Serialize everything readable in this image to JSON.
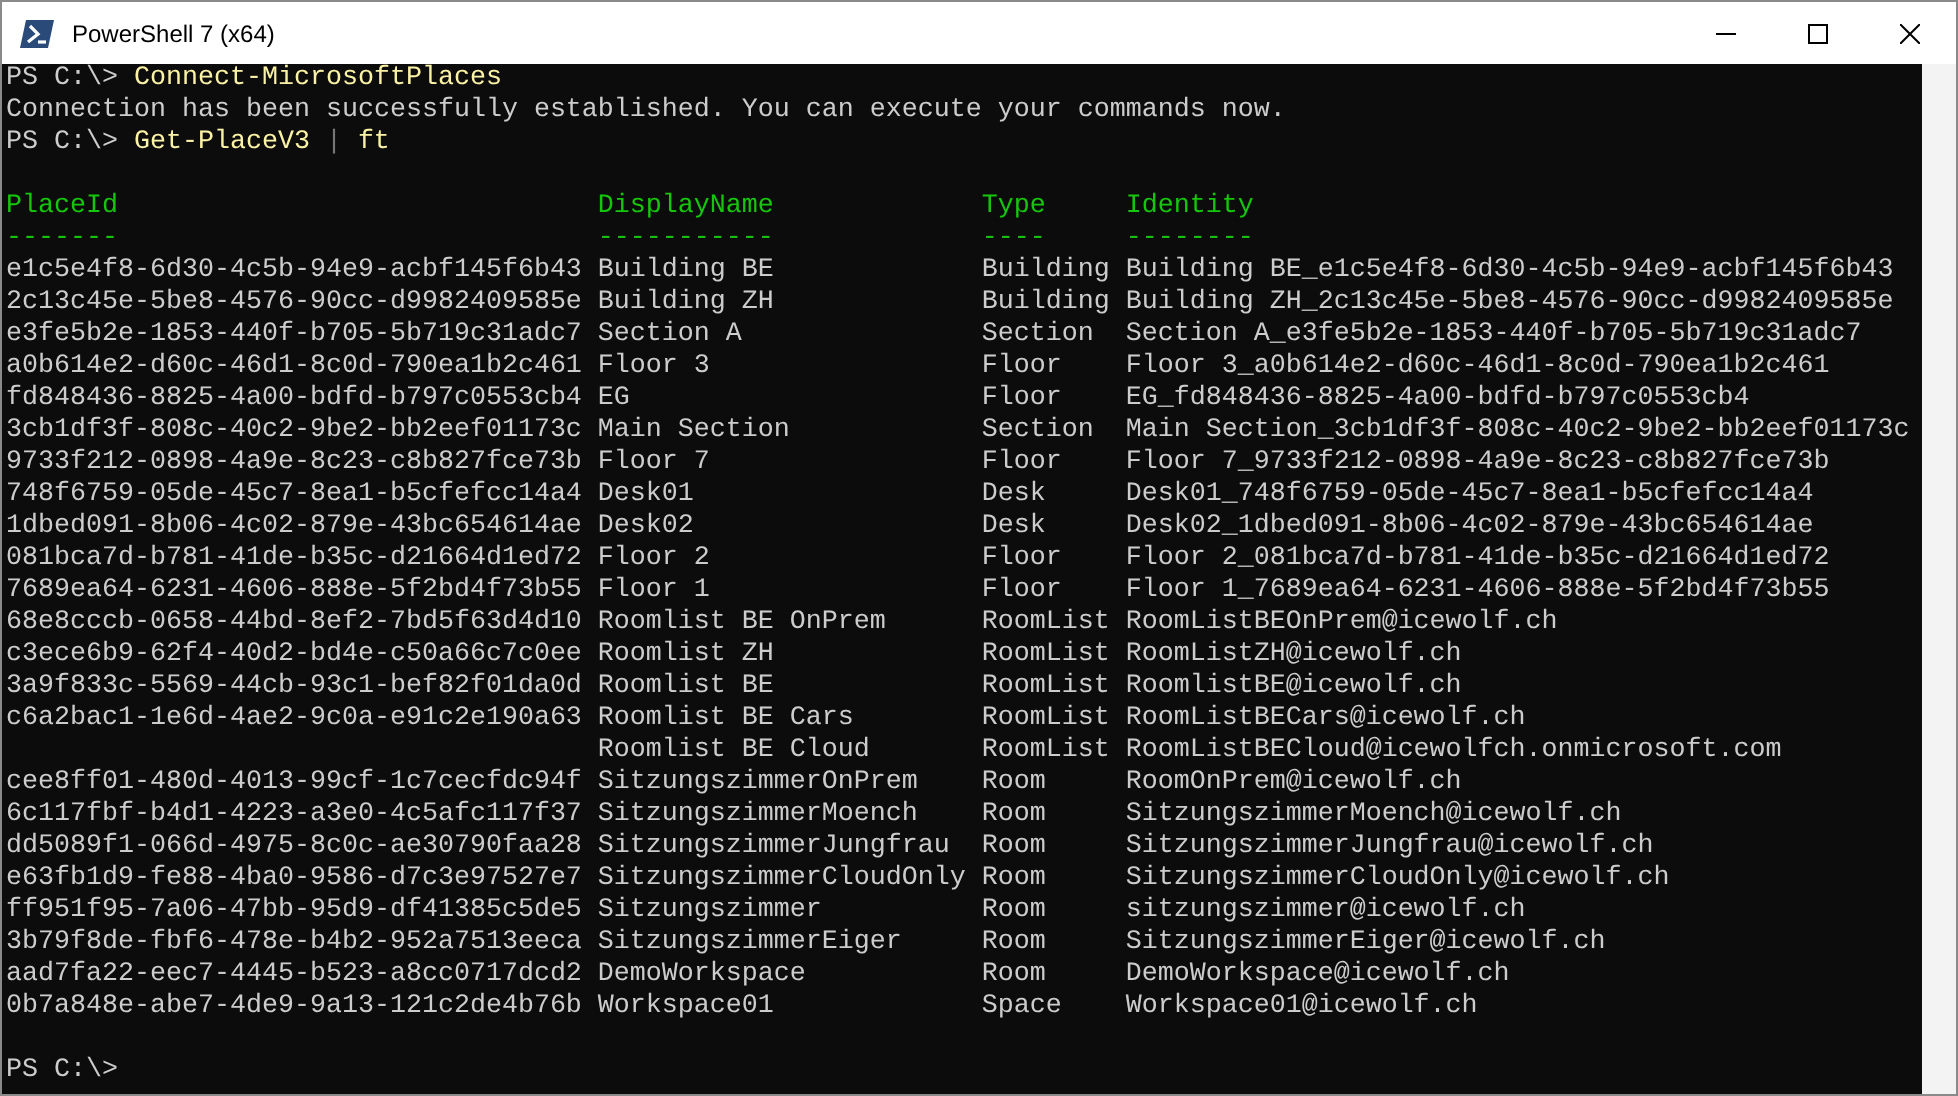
{
  "window": {
    "title": "PowerShell 7 (x64)"
  },
  "session_start": [
    {
      "kind": "command",
      "prompt": "PS C:\\>",
      "command": "Connect-MicrosoftPlaces"
    },
    {
      "kind": "output",
      "text": "Connection has been successfully established. You can execute your commands now."
    },
    {
      "kind": "command",
      "prompt": "PS C:\\>",
      "command": "Get-PlaceV3",
      "pipe": "|",
      "argument": "ft"
    }
  ],
  "table": {
    "columns": [
      {
        "heading": "PlaceId",
        "underline": "-------"
      },
      {
        "heading": "DisplayName",
        "underline": "-----------"
      },
      {
        "heading": "Type",
        "underline": "----"
      },
      {
        "heading": "Identity",
        "underline": "--------"
      }
    ],
    "rows": [
      {
        "place_id": "e1c5e4f8-6d30-4c5b-94e9-acbf145f6b43",
        "display_name": "Building BE",
        "type": "Building",
        "identity": "Building BE_e1c5e4f8-6d30-4c5b-94e9-acbf145f6b43"
      },
      {
        "place_id": "2c13c45e-5be8-4576-90cc-d9982409585e",
        "display_name": "Building ZH",
        "type": "Building",
        "identity": "Building ZH_2c13c45e-5be8-4576-90cc-d9982409585e"
      },
      {
        "place_id": "e3fe5b2e-1853-440f-b705-5b719c31adc7",
        "display_name": "Section A",
        "type": "Section",
        "identity": "Section A_e3fe5b2e-1853-440f-b705-5b719c31adc7"
      },
      {
        "place_id": "a0b614e2-d60c-46d1-8c0d-790ea1b2c461",
        "display_name": "Floor 3",
        "type": "Floor",
        "identity": "Floor 3_a0b614e2-d60c-46d1-8c0d-790ea1b2c461"
      },
      {
        "place_id": "fd848436-8825-4a00-bdfd-b797c0553cb4",
        "display_name": "EG",
        "type": "Floor",
        "identity": "EG_fd848436-8825-4a00-bdfd-b797c0553cb4"
      },
      {
        "place_id": "3cb1df3f-808c-40c2-9be2-bb2eef01173c",
        "display_name": "Main Section",
        "type": "Section",
        "identity": "Main Section_3cb1df3f-808c-40c2-9be2-bb2eef01173c"
      },
      {
        "place_id": "9733f212-0898-4a9e-8c23-c8b827fce73b",
        "display_name": "Floor 7",
        "type": "Floor",
        "identity": "Floor 7_9733f212-0898-4a9e-8c23-c8b827fce73b"
      },
      {
        "place_id": "748f6759-05de-45c7-8ea1-b5cfefcc14a4",
        "display_name": "Desk01",
        "type": "Desk",
        "identity": "Desk01_748f6759-05de-45c7-8ea1-b5cfefcc14a4"
      },
      {
        "place_id": "1dbed091-8b06-4c02-879e-43bc654614ae",
        "display_name": "Desk02",
        "type": "Desk",
        "identity": "Desk02_1dbed091-8b06-4c02-879e-43bc654614ae"
      },
      {
        "place_id": "081bca7d-b781-41de-b35c-d21664d1ed72",
        "display_name": "Floor 2",
        "type": "Floor",
        "identity": "Floor 2_081bca7d-b781-41de-b35c-d21664d1ed72"
      },
      {
        "place_id": "7689ea64-6231-4606-888e-5f2bd4f73b55",
        "display_name": "Floor 1",
        "type": "Floor",
        "identity": "Floor 1_7689ea64-6231-4606-888e-5f2bd4f73b55"
      },
      {
        "place_id": "68e8cccb-0658-44bd-8ef2-7bd5f63d4d10",
        "display_name": "Roomlist BE OnPrem",
        "type": "RoomList",
        "identity": "RoomListBEOnPrem@icewolf.ch"
      },
      {
        "place_id": "c3ece6b9-62f4-40d2-bd4e-c50a66c7c0ee",
        "display_name": "Roomlist ZH",
        "type": "RoomList",
        "identity": "RoomListZH@icewolf.ch"
      },
      {
        "place_id": "3a9f833c-5569-44cb-93c1-bef82f01da0d",
        "display_name": "Roomlist BE",
        "type": "RoomList",
        "identity": "RoomlistBE@icewolf.ch"
      },
      {
        "place_id": "c6a2bac1-1e6d-4ae2-9c0a-e91c2e190a63",
        "display_name": "Roomlist BE Cars",
        "type": "RoomList",
        "identity": "RoomListBECars@icewolf.ch"
      },
      {
        "display_name": "Roomlist BE Cloud",
        "type": "RoomList",
        "identity": "RoomListBECloud@icewolfch.onmicrosoft.com"
      },
      {
        "place_id": "cee8ff01-480d-4013-99cf-1c7cecfdc94f",
        "display_name": "SitzungszimmerOnPrem",
        "type": "Room",
        "identity": "RoomOnPrem@icewolf.ch"
      },
      {
        "place_id": "6c117fbf-b4d1-4223-a3e0-4c5afc117f37",
        "display_name": "SitzungszimmerMoench",
        "type": "Room",
        "identity": "SitzungszimmerMoench@icewolf.ch"
      },
      {
        "place_id": "dd5089f1-066d-4975-8c0c-ae30790faa28",
        "display_name": "SitzungszimmerJungfrau",
        "type": "Room",
        "identity": "SitzungszimmerJungfrau@icewolf.ch"
      },
      {
        "place_id": "e63fb1d9-fe88-4ba0-9586-d7c3e97527e7",
        "display_name": "SitzungszimmerCloudOnly",
        "type": "Room",
        "identity": "SitzungszimmerCloudOnly@icewolf.ch"
      },
      {
        "place_id": "ff951f95-7a06-47bb-95d9-df41385c5de5",
        "display_name": "Sitzungszimmer",
        "type": "Room",
        "identity": "sitzungszimmer@icewolf.ch"
      },
      {
        "place_id": "3b79f8de-fbf6-478e-b4b2-952a7513eeca",
        "display_name": "SitzungszimmerEiger",
        "type": "Room",
        "identity": "SitzungszimmerEiger@icewolf.ch"
      },
      {
        "place_id": "aad7fa22-eec7-4445-b523-a8cc0717dcd2",
        "display_name": "DemoWorkspace",
        "type": "Room",
        "identity": "DemoWorkspace@icewolf.ch"
      },
      {
        "place_id": "0b7a848e-abe7-4de9-9a13-121c2de4b76b",
        "display_name": "Workspace01",
        "type": "Space",
        "identity": "Workspace01@icewolf.ch"
      }
    ]
  },
  "final_prompt": {
    "prompt": "PS C:\\>"
  }
}
